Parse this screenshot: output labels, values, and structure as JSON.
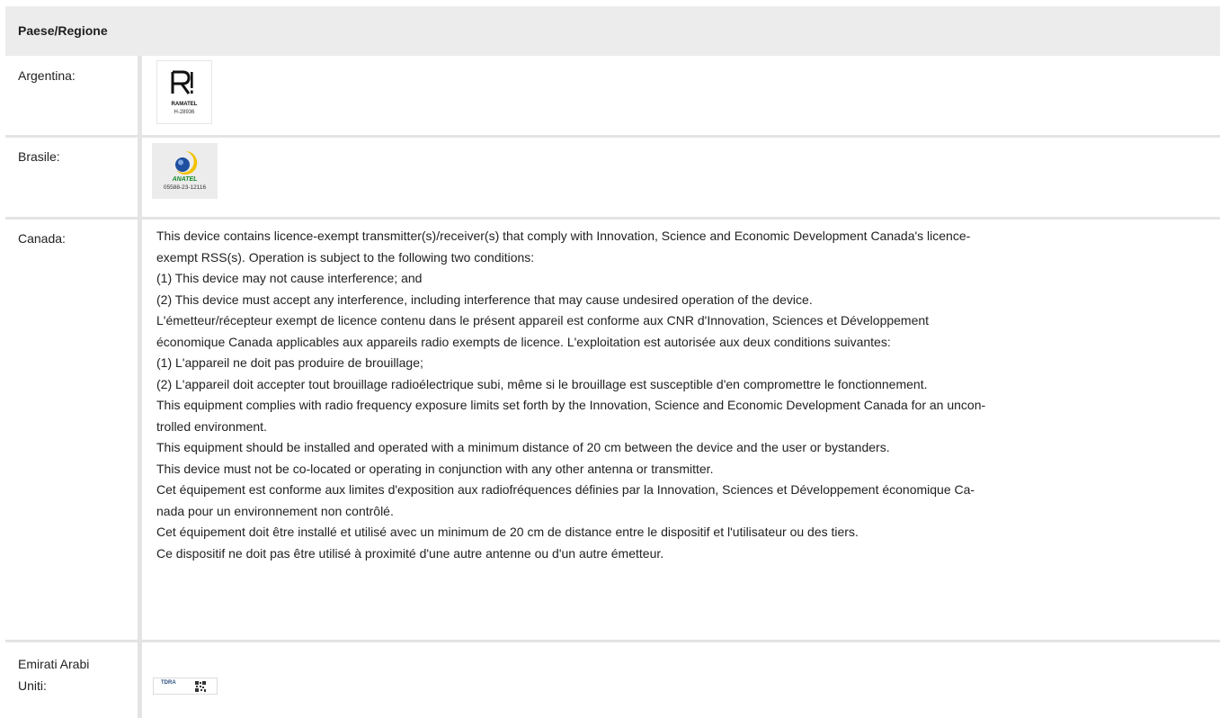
{
  "table": {
    "header": "Paese/Regione",
    "rows": [
      {
        "country": "Argentina:",
        "logo": {
          "icon": "ramatel-logo",
          "name": "RAMATEL",
          "code": "H-28936"
        }
      },
      {
        "country": "Brasile:",
        "logo": {
          "icon": "anatel-logo",
          "name": "ANATEL",
          "code": "05588-23-12116"
        }
      },
      {
        "country": "Canada:",
        "lines": [
          "This device contains licence-exempt transmitter(s)/receiver(s) that comply with Innovation, Science and Economic Development Canada's licence-",
          "exempt RSS(s). Operation is subject to the following two conditions:",
          "(1) This device may not cause interference; and",
          "(2) This device must accept any interference, including interference that may cause undesired operation of the device.",
          "L'émetteur/récepteur exempt de licence contenu dans le présent appareil est conforme aux CNR d'Innovation, Sciences et Développement",
          "économique Canada applicables aux appareils radio exempts de licence. L'exploitation est autorisée aux deux conditions suivantes:",
          "(1) L'appareil ne doit pas produire de brouillage;",
          "(2) L'appareil doit accepter tout brouillage radioélectrique subi, même si le brouillage est susceptible d'en compromettre le fonctionnement.",
          "This equipment complies with radio frequency exposure limits set forth by the Innovation, Science and Economic Development Canada for an uncon-",
          "trolled environment.",
          "This equipment should be installed and operated with a minimum distance of 20 cm between the device and the user or bystanders.",
          "This device must not be co-located or operating in conjunction with any other antenna or transmitter.",
          "Cet équipement est conforme aux limites d'exposition aux radiofréquences définies par la Innovation, Sciences et Développement économique Ca-",
          "nada pour un environnement non contrôlé.",
          "Cet équipement doit être installé et utilisé avec un minimum de 20 cm de distance entre le dispositif et l'utilisateur ou des tiers.",
          "Ce dispositif ne doit pas être utilisé à proximité d'une autre antenne ou d'un autre émetteur."
        ]
      },
      {
        "country_line1": "Emirati Arabi",
        "country_line2": "Uniti:",
        "logo": {
          "icon": "tdra-logo",
          "name": "TDRA"
        }
      }
    ]
  }
}
